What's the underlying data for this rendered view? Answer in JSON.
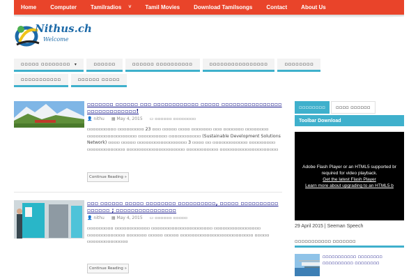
{
  "topnav": {
    "items": [
      {
        "label": "Home"
      },
      {
        "label": "Computer"
      },
      {
        "label": "Tamilradios",
        "chevron": "˅"
      },
      {
        "label": "Tamil Movies"
      },
      {
        "label": "Download Tamilsongs"
      },
      {
        "label": "Contact"
      },
      {
        "label": "About Us"
      }
    ]
  },
  "logo": {
    "title": "Nithus.ch",
    "subtitle": "Welcome"
  },
  "menu": {
    "row1": [
      {
        "label": "▫▫▫▫▫ ▫▫▫▫▫▫▫▫",
        "caret": "▾"
      },
      {
        "label": "▫▫▫▫▫▫"
      },
      {
        "label": "▫▫▫▫▫▫ ▫▫▫▫▫▫▫▫▫▫"
      },
      {
        "label": "▫▫▫▫▫▫▫▫▫▫▫▫▫▫▫▫"
      },
      {
        "label": "▫▫▫▫▫▫▫▫"
      }
    ],
    "row2": [
      {
        "label": "▫▫▫▫▫▫▫▫▫▫▫"
      },
      {
        "label": "▫▫▫▫▫▫ ▫▫▫▫▫"
      }
    ]
  },
  "posts": [
    {
      "title": "▫▫▫▫▫▫▫ ▫▫▫▫▫▫ ▫▫▫ ▫▫▫▫▫▫▫▫▫▫▫▫ ▫▫▫▫▫ ▫▫▫▫▫▫▫▫▫▫▫▫▫▫▫▫ ▫▫▫▫▫▫▫▫▫▫▫▫▫!",
      "author": "nithu",
      "date": "May 4, 2015",
      "category": "▫▫▫▫▫▫ ▫▫▫▫▫▫▫▫",
      "excerpt": "▫▫▫▫▫▫▫▫▫▫ ▫▫▫▫▫▫▫▫▫ 23 ▫▫▫ ▫▫▫▫▫ ▫▫▫▫ ▫▫▫▫▫▫▫ ▫▫▫ ▫▫▫▫▫▫▫ ▫▫▫▫▫▫▫▫ ▫▫▫▫▫▫▫▫▫▫▫▫▫▫▫▫▫ ▫▫▫▫▫▫▫▫▫▫ ▫▫▫▫▫▫▫▫▫▫▫ (Sustainable Development Solutions Network) ▫▫▫▫ ▫▫▫▫▫ ▫▫▫▫▫▫▫▫▫▫▫▫▫▫▫▫▫ 3 ▫▫▫▫ ▫▫ ▫▫▫▫▫▫▫▫▫▫▫▫ ▫▫▫▫▫▫▫▫▫ ▫▫▫▫▫▫▫▫▫▫▫▫▫ ▫▫▫▫▫▫▫▫▫▫▫▫▫▫▫▫▫▫▫▫ ▫▫▫▫▫▫▫▫▫▫▫ ▫▫▫▫▫▫▫▫▫▫▫▫▫▫▫▫▫▫▫▫",
      "read_more": "Continue Reading »"
    },
    {
      "title": "▫▫▫ ▫▫▫▫▫▫ ▫▫▫▫▫ ▫▫▫▫▫▫▫▫ ▫▫▫▫▫▫▫▫▫▫, ▫▫▫▫▫ ▫▫▫▫▫▫▫▫▫▫ ▫▫▫▫▫▫ ; ▫▫▫▫▫▫▫▫▫▫▫▫▫▫▫▫",
      "author": "nithu",
      "date": "May 4, 2015",
      "category": "▫▫▫▫▫▫ ▫▫▫▫▫",
      "excerpt": "▫▫▫▫▫▫▫▫▫ ▫▫▫▫▫▫▫▫▫▫▫▫ ▫▫▫▫▫▫▫▫▫▫▫▫▫▫▫▫▫▫▫▫▫ ▫▫▫▫▫▫▫▫▫▫▫▫▫▫▫▫ ▫▫▫▫▫▫▫▫▫▫▫▫▫ ▫▫▫▫▫▫▫ ▫▫▫▫▫ ▫▫▫▫▫ ▫▫▫▫▫▫▫▫▫▫▫▫▫▫▫▫▫▫▫▫▫▫▫▫▫ ▫▫▫▫▫ ▫▫▫▫▫▫▫▫▫▫▫▫▫▫",
      "read_more": "Continue Reading »"
    }
  ],
  "sidebar": {
    "tabs": [
      {
        "label": "▫▫▫▫▫▫▫▫",
        "active": true
      },
      {
        "label": "▫▫▫▫ ▫▫▫▫▫▫",
        "active": false
      }
    ],
    "toolbar_title": "Toolbar Download",
    "video": {
      "line1": "Adobe Flash Player or an HTML5 supported br",
      "line2": "required for video playback.",
      "link1": "Get the latest Flash Player",
      "link2": "Learn more about upgrading to an HTML5 b"
    },
    "caption": "29 April 2015 | Seeman Speech",
    "section_title": "▫▫▫▫▫▫▫▫▫▫▫ ▫▫▫▫▫▫▫",
    "side_post_title": "▫▫▫▫▫▫▫▫▫▫▫ ▫▫▫▫▫▫▫▫ ▫▫▫▫▫▫▫▫▫▫ ▫▫▫▫▫▫▫▫"
  },
  "colors": {
    "nav": "#e9442a",
    "accent": "#3fb0cc",
    "title_link": "#1a1a8c"
  }
}
